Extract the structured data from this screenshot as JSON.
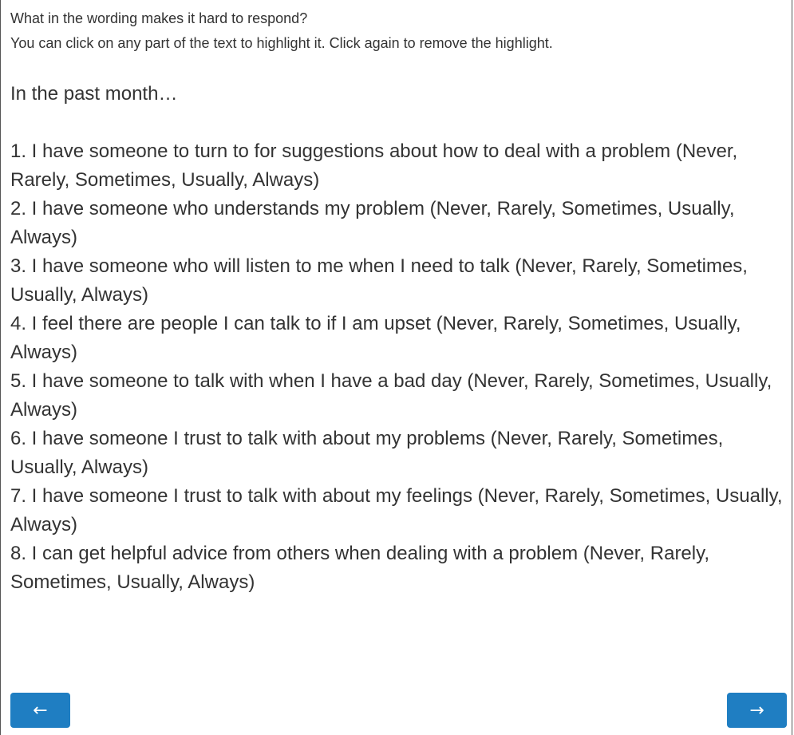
{
  "prompt": {
    "question": "What in the wording makes it hard to respond?",
    "instruction": "You can click on any part of the text to highlight it. Click again to remove the highlight."
  },
  "survey": {
    "intro": "In the past month…",
    "items": [
      "1. I have someone to turn to for suggestions about how to deal with a problem (Never, Rarely, Sometimes, Usually, Always)",
      "2. I have someone who understands my problem (Never, Rarely, Sometimes, Usually, Always)",
      "3. I have someone who will listen to me when I need to talk (Never, Rarely, Sometimes, Usually, Always)",
      "4. I feel there are people I can talk to if I am upset (Never, Rarely, Sometimes, Usually, Always)",
      "5. I have someone to talk with when I have a bad day (Never, Rarely, Sometimes, Usually, Always)",
      "6. I have someone I trust to talk with about my problems (Never, Rarely, Sometimes, Usually, Always)",
      "7. I have someone I trust to talk with about my feelings (Never, Rarely, Sometimes, Usually, Always)",
      "8. I can get helpful advice from others when dealing with a problem (Never, Rarely, Sometimes, Usually, Always)"
    ]
  },
  "nav": {
    "back_label": "←",
    "next_label": "→",
    "button_color": "#1f7ec2"
  }
}
